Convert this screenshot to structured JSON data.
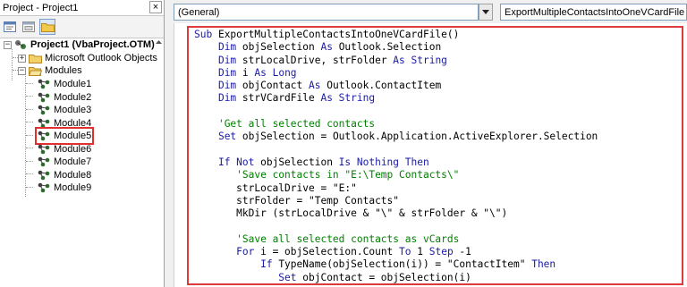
{
  "project_explorer": {
    "title": "Project - Project1",
    "close_glyph": "×",
    "toolbar_icons": [
      "view-code-icon",
      "view-object-icon",
      "toggle-folders-icon"
    ],
    "root": {
      "label": "Project1 (VbaProject.OTM)",
      "expander": "−"
    },
    "nodes": [
      {
        "label": "Microsoft Outlook Objects",
        "expander": "+"
      },
      {
        "label": "Modules",
        "expander": "−"
      }
    ],
    "modules": [
      "Module1",
      "Module2",
      "Module3",
      "Module4",
      "Module5",
      "Module6",
      "Module7",
      "Module8",
      "Module9"
    ],
    "selected_module": "Module5"
  },
  "code_window": {
    "object_combo": "(General)",
    "procedure_combo": "ExportMultipleContactsIntoOneVCardFile",
    "highlight_color": "#dd3b3b",
    "keyword_color": "#1a1aa6",
    "comment_color": "#007f00"
  },
  "code_lines": [
    [
      [
        "kw",
        "Sub "
      ],
      [
        "t",
        "ExportMultipleContactsIntoOneVCardFile()"
      ]
    ],
    [
      [
        "t",
        "    "
      ],
      [
        "kw",
        "Dim "
      ],
      [
        "t",
        "objSelection "
      ],
      [
        "kw",
        "As "
      ],
      [
        "t",
        "Outlook.Selection"
      ]
    ],
    [
      [
        "t",
        "    "
      ],
      [
        "kw",
        "Dim "
      ],
      [
        "t",
        "strLocalDrive, strFolder "
      ],
      [
        "kw",
        "As String"
      ]
    ],
    [
      [
        "t",
        "    "
      ],
      [
        "kw",
        "Dim "
      ],
      [
        "t",
        "i "
      ],
      [
        "kw",
        "As Long"
      ]
    ],
    [
      [
        "t",
        "    "
      ],
      [
        "kw",
        "Dim "
      ],
      [
        "t",
        "objContact "
      ],
      [
        "kw",
        "As "
      ],
      [
        "t",
        "Outlook.ContactItem"
      ]
    ],
    [
      [
        "t",
        "    "
      ],
      [
        "kw",
        "Dim "
      ],
      [
        "t",
        "strVCardFile "
      ],
      [
        "kw",
        "As String"
      ]
    ],
    [
      [
        "t",
        ""
      ]
    ],
    [
      [
        "t",
        "    "
      ],
      [
        "cm",
        "'Get all selected contacts"
      ]
    ],
    [
      [
        "t",
        "    "
      ],
      [
        "kw",
        "Set "
      ],
      [
        "t",
        "objSelection = Outlook.Application.ActiveExplorer.Selection"
      ]
    ],
    [
      [
        "t",
        ""
      ]
    ],
    [
      [
        "t",
        "    "
      ],
      [
        "kw",
        "If Not "
      ],
      [
        "t",
        "objSelection "
      ],
      [
        "kw",
        "Is Nothing Then"
      ]
    ],
    [
      [
        "t",
        "       "
      ],
      [
        "cm",
        "'Save contacts in \"E:\\Temp Contacts\\\""
      ]
    ],
    [
      [
        "t",
        "       strLocalDrive = \"E:\""
      ]
    ],
    [
      [
        "t",
        "       strFolder = \"Temp Contacts\""
      ]
    ],
    [
      [
        "t",
        "       MkDir (strLocalDrive & \"\\\" & strFolder & \"\\\")"
      ]
    ],
    [
      [
        "t",
        ""
      ]
    ],
    [
      [
        "t",
        "       "
      ],
      [
        "cm",
        "'Save all selected contacts as vCards"
      ]
    ],
    [
      [
        "t",
        "       "
      ],
      [
        "kw",
        "For "
      ],
      [
        "t",
        "i = objSelection.Count "
      ],
      [
        "kw",
        "To "
      ],
      [
        "t",
        "1 "
      ],
      [
        "kw",
        "Step "
      ],
      [
        "t",
        "-1"
      ]
    ],
    [
      [
        "t",
        "           "
      ],
      [
        "kw",
        "If "
      ],
      [
        "t",
        "TypeName(objSelection(i)) = \"ContactItem\" "
      ],
      [
        "kw",
        "Then"
      ]
    ],
    [
      [
        "t",
        "              "
      ],
      [
        "kw",
        "Set "
      ],
      [
        "t",
        "objContact = objSelection(i)"
      ]
    ]
  ]
}
